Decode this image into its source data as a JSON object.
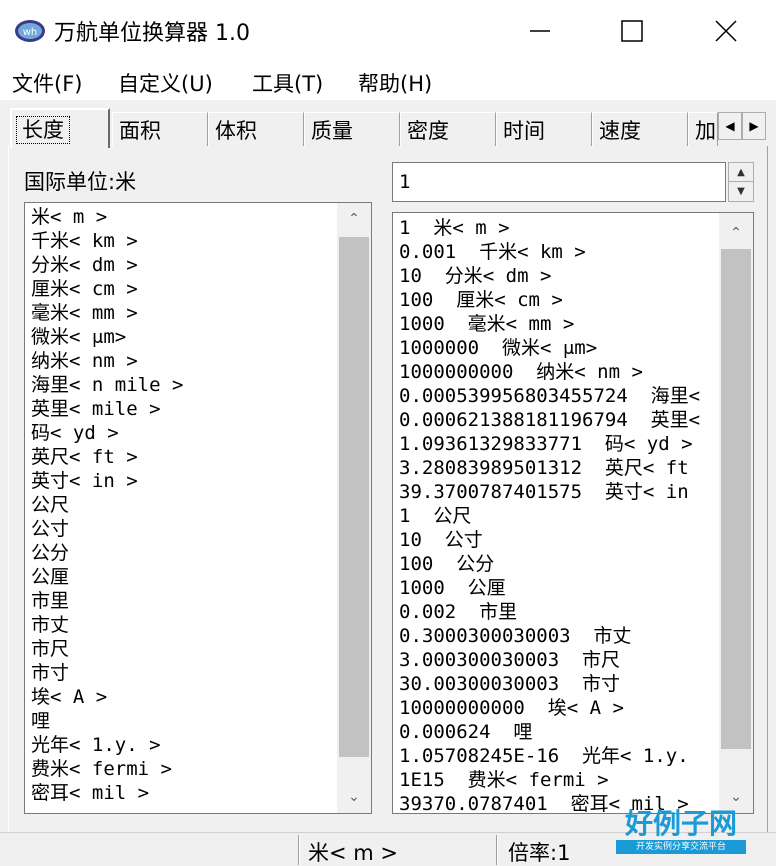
{
  "window": {
    "title": "万航单位换算器 1.0"
  },
  "menu": [
    "文件(F)",
    "自定义(U)",
    "工具(T)",
    "帮助(H)"
  ],
  "tabs": [
    "长度",
    "面积",
    "体积",
    "质量",
    "密度",
    "时间",
    "速度",
    "加"
  ],
  "active_tab": "长度",
  "intl_unit_label": "国际单位:米",
  "input_value": "1",
  "unit_list": [
    "米< m >",
    "千米< km >",
    "分米< dm >",
    "厘米< cm >",
    "毫米< mm >",
    "微米< μm>",
    "纳米< nm >",
    "海里< n mile >",
    "英里< mile >",
    "码< yd >",
    "英尺< ft >",
    "英寸< in >",
    "公尺",
    "公寸",
    "公分",
    "公厘",
    "市里",
    "市丈",
    "市尺",
    "市寸",
    "埃< A >",
    "哩",
    "光年< 1.y. >",
    "费米< fermi >",
    "密耳< mil >"
  ],
  "results": [
    "1  米< m >",
    "0.001  千米< km >",
    "10  分米< dm >",
    "100  厘米< cm >",
    "1000  毫米< mm >",
    "1000000  微米< μm>",
    "1000000000  纳米< nm >",
    "0.000539956803455724  海里<",
    "0.000621388181196794  英里<",
    "1.09361329833771  码< yd >",
    "3.28083989501312  英尺< ft",
    "39.3700787401575  英寸< in",
    "1  公尺",
    "10  公寸",
    "100  公分",
    "1000  公厘",
    "0.002  市里",
    "0.3000300030003  市丈",
    "3.000300030003  市尺",
    "30.00300030003  市寸",
    "10000000000  埃< A >",
    "0.000624  哩",
    "1.05708245E-16  光年< 1.y.",
    "1E15  费米< fermi >",
    "39370.0787401  密耳< mil >"
  ],
  "status": {
    "unit": "米< m >",
    "ratio": "倍率:1"
  },
  "watermark": {
    "main": "好例子网",
    "sub": "开发实例分享交流平台"
  },
  "colors": {
    "accent": "#1a9ad6",
    "scroll_thumb": "#c2c2c2",
    "face": "#f0f0f0"
  }
}
